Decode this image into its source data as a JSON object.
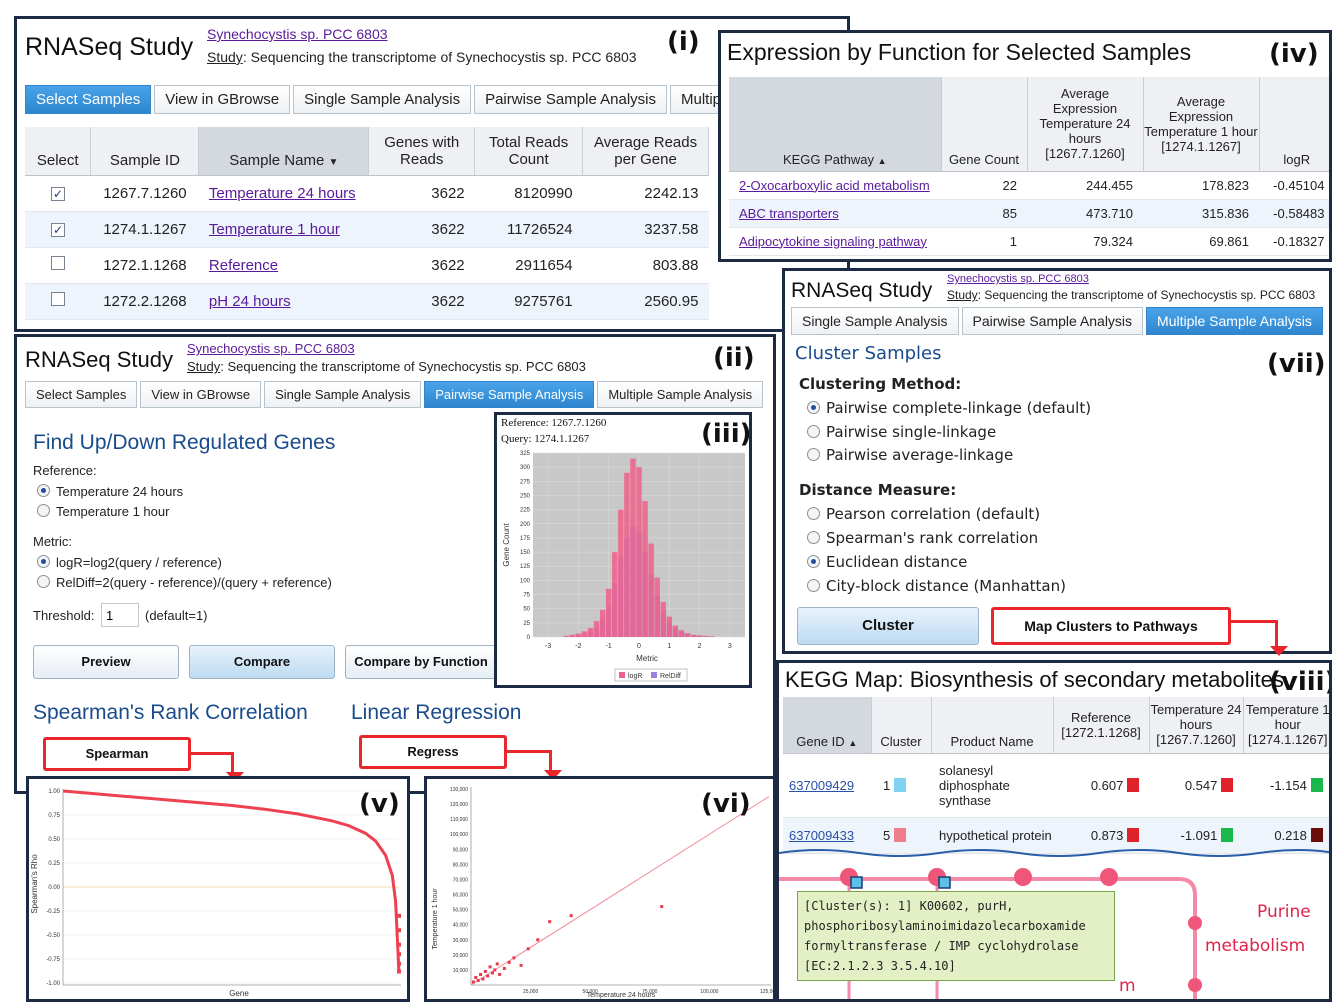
{
  "panel_i": {
    "label": "(i)",
    "title": "RNASeq Study",
    "organism": "Synechocystis sp. PCC 6803",
    "study_key": "Study",
    "study_text": ": Sequencing the transcriptome of Synechocystis sp. PCC 6803",
    "tabs": [
      "Select Samples",
      "View in GBrowse",
      "Single Sample Analysis",
      "Pairwise Sample Analysis",
      "Multip"
    ],
    "columns": [
      "Select",
      "Sample ID",
      "Sample Name",
      "Genes with Reads",
      "Total Reads Count",
      "Average Reads per Gene"
    ],
    "rows": [
      {
        "checked": true,
        "id": "1267.7.1260",
        "name": "Temperature 24 hours",
        "genes": "3622",
        "total": "8120990",
        "avg": "2242.13"
      },
      {
        "checked": true,
        "id": "1274.1.1267",
        "name": "Temperature 1 hour",
        "genes": "3622",
        "total": "11726524",
        "avg": "3237.58"
      },
      {
        "checked": false,
        "id": "1272.1.1268",
        "name": "Reference",
        "genes": "3622",
        "total": "2911654",
        "avg": "803.88"
      },
      {
        "checked": false,
        "id": "1272.2.1268",
        "name": "pH 24 hours",
        "genes": "3622",
        "total": "9275761",
        "avg": "2560.95"
      }
    ]
  },
  "panel_iv": {
    "label": "(iv)",
    "title": "Expression by Function for Selected Samples",
    "columns": [
      "KEGG Pathway",
      "Gene Count",
      "Average Expression Temperature 24 hours [1267.7.1260]",
      "Average Expression Temperature 1 hour [1274.1.1267]",
      "logR"
    ],
    "rows": [
      {
        "pathway": "2-Oxocarboxylic acid metabolism",
        "count": "22",
        "a": "244.455",
        "b": "178.823",
        "logr": "-0.45104"
      },
      {
        "pathway": "ABC transporters",
        "count": "85",
        "a": "473.710",
        "b": "315.836",
        "logr": "-0.58483"
      },
      {
        "pathway": "Adipocytokine signaling pathway",
        "count": "1",
        "a": "79.324",
        "b": "69.861",
        "logr": "-0.18327"
      }
    ]
  },
  "panel_ii": {
    "label": "(ii)",
    "title": "RNASeq Study",
    "organism": "Synechocystis sp. PCC 6803",
    "study_key": "Study",
    "study_text": ": Sequencing the transcriptome of Synechocystis sp. PCC 6803",
    "tabs": [
      "Select Samples",
      "View in GBrowse",
      "Single Sample Analysis",
      "Pairwise Sample Analysis",
      "Multiple Sample Analysis"
    ],
    "heading": "Find Up/Down Regulated Genes",
    "reference_label": "Reference",
    "reference_options": [
      "Temperature 24 hours",
      "Temperature 1 hour"
    ],
    "metric_label": "Metric",
    "metric_options": [
      "logR=log2(query / reference)",
      "RelDiff=2(query - reference)/(query + reference)"
    ],
    "threshold_label": "Threshold",
    "threshold_value": "1",
    "threshold_default": "(default=1)",
    "buttons": [
      "Preview",
      "Compare",
      "Compare by Function"
    ],
    "spearman_title": "Spearman's Rank Correlation",
    "spearman_button": "Spearman",
    "regression_title": "Linear Regression",
    "regression_button": "Regress"
  },
  "panel_iii": {
    "label": "(iii)",
    "reference_line": "Reference: 1267.7.1260",
    "query_line": "Query: 1274.1.1267"
  },
  "panel_v": {
    "label": "(v)"
  },
  "panel_vi": {
    "label": "(vi)"
  },
  "panel_vii": {
    "label": "(vii)",
    "title": "RNASeq Study",
    "organism": "Synechocystis sp. PCC 6803",
    "study_key": "Study",
    "study_text": ": Sequencing the transcriptome of Synechocystis sp. PCC 6803",
    "tabs": [
      "Single Sample Analysis",
      "Pairwise Sample Analysis",
      "Multiple Sample Analysis"
    ],
    "heading": "Cluster Samples",
    "method_label": "Clustering Method",
    "method_options": [
      "Pairwise complete-linkage (default)",
      "Pairwise single-linkage",
      "Pairwise average-linkage"
    ],
    "distance_label": "Distance Measure",
    "distance_options": [
      "Pearson correlation (default)",
      "Spearman's rank correlation",
      "Euclidean distance",
      "City-block distance (Manhattan)"
    ],
    "cluster_button": "Cluster",
    "map_button": "Map Clusters to Pathways"
  },
  "panel_viii": {
    "label": "(viii)",
    "title": "KEGG Map: Biosynthesis of secondary metabolites",
    "columns": [
      "Gene ID",
      "Cluster",
      "Product Name",
      "Reference [1272.1.1268]",
      "Temperature 24 hours [1267.7.1260]",
      "Temperature 1 hour [1274.1.1267]"
    ],
    "rows": [
      {
        "gene": "637009429",
        "cluster": "1",
        "cluster_color": "#7fd3f0",
        "product": "solanesyl diphosphate synthase",
        "ref": "0.607",
        "ref_color": "#e0232a",
        "t24": "0.547",
        "t24_color": "#e0232a",
        "t1": "-1.154",
        "t1_color": "#19b84a"
      },
      {
        "gene": "637009433",
        "cluster": "5",
        "cluster_color": "#ee7f8a",
        "product": "hypothetical protein",
        "ref": "0.873",
        "ref_color": "#e0232a",
        "t24": "-1.091",
        "t24_color": "#19b84a",
        "t1": "0.218",
        "t1_color": "#6b0d0d"
      }
    ],
    "tooltip": "[Cluster(s): 1] K00602, purH, phosphoribosylaminoimidazolecarboxamide formyltransferase / IMP cyclohydrolase [EC:2.1.2.3 3.5.4.10]",
    "map_text_1": "Purine",
    "map_text_2": "metabolism",
    "map_text_3": "m"
  },
  "chart_data": [
    {
      "type": "bar",
      "title": "",
      "xlabel": "Metric",
      "ylabel": "Gene Count",
      "xlim": [
        -3.5,
        3.5
      ],
      "ylim": [
        0,
        325
      ],
      "y_ticks": [
        0,
        25,
        50,
        75,
        100,
        125,
        150,
        175,
        200,
        225,
        250,
        275,
        300,
        325
      ],
      "x_ticks": [
        -3,
        -2,
        -1,
        0,
        1,
        2,
        3
      ],
      "legend": [
        "logR",
        "RelDiff"
      ],
      "series": [
        {
          "name": "logR",
          "color": "#f0608a",
          "x": [
            -2.4,
            -2.2,
            -2.0,
            -1.8,
            -1.6,
            -1.4,
            -1.2,
            -1.0,
            -0.8,
            -0.6,
            -0.4,
            -0.2,
            0.0,
            0.2,
            0.4,
            0.6,
            0.8,
            1.0,
            1.2,
            1.4,
            1.6,
            1.8,
            2.0,
            2.2,
            2.4
          ],
          "values": [
            2,
            4,
            6,
            10,
            16,
            28,
            48,
            85,
            150,
            225,
            290,
            315,
            300,
            240,
            165,
            105,
            62,
            36,
            20,
            12,
            7,
            4,
            3,
            2,
            1
          ]
        },
        {
          "name": "RelDiff",
          "color": "#9a80e0",
          "x": [
            -2.4,
            -2.2,
            -2.0,
            -1.8,
            -1.6,
            -1.4,
            -1.2,
            -1.0,
            -0.8,
            -0.6,
            -0.4,
            -0.2,
            0.0,
            0.2,
            0.4,
            0.6,
            0.8,
            1.0,
            1.2,
            1.4,
            1.6,
            1.8,
            2.0,
            2.2,
            2.4
          ],
          "values": [
            1,
            2,
            3,
            6,
            10,
            18,
            32,
            55,
            95,
            140,
            175,
            195,
            185,
            150,
            110,
            72,
            44,
            26,
            15,
            9,
            5,
            3,
            2,
            1,
            1
          ]
        }
      ]
    },
    {
      "type": "line",
      "title": "",
      "xlabel": "Gene",
      "ylabel": "Spearman's Rho",
      "ylim": [
        -1.0,
        1.0
      ],
      "y_ticks": [
        "1.00",
        "0.75",
        "0.50",
        "0.25",
        "0.00",
        "-0.25",
        "-0.50",
        "-0.75",
        "-1.00"
      ],
      "series": [
        {
          "name": "",
          "color": "#ee4050",
          "x": [
            0,
            0.1,
            0.2,
            0.3,
            0.4,
            0.5,
            0.6,
            0.7,
            0.8,
            0.85,
            0.9,
            0.93,
            0.96,
            0.98,
            0.99,
            1.0
          ],
          "values": [
            1.0,
            0.97,
            0.94,
            0.91,
            0.88,
            0.85,
            0.81,
            0.76,
            0.69,
            0.64,
            0.56,
            0.48,
            0.33,
            0.12,
            -0.15,
            -0.9
          ]
        }
      ]
    },
    {
      "type": "scatter",
      "title": "",
      "xlabel": "Temperature 24 hours",
      "ylabel": "Temperature 1 hour",
      "xlim": [
        0,
        125000
      ],
      "ylim": [
        0,
        130000
      ],
      "x_ticks": [
        "25,000",
        "50,000",
        "75,000",
        "100,000",
        "125,000"
      ],
      "y_ticks": [
        "10,000",
        "20,000",
        "30,000",
        "40,000",
        "50,000",
        "60,000",
        "70,000",
        "80,000",
        "90,000",
        "100,000",
        "110,000",
        "120,000",
        "130,000"
      ],
      "series": [
        {
          "name": "",
          "color": "#e63a4a",
          "x": [
            1000,
            2000,
            3000,
            4000,
            5000,
            6000,
            7000,
            8000,
            9000,
            10000,
            11000,
            12000,
            14000,
            16000,
            18000,
            21000,
            24000,
            28000,
            33000,
            42000,
            80000
          ],
          "values": [
            2000,
            5000,
            3000,
            7000,
            4000,
            9000,
            6000,
            12000,
            8000,
            10000,
            14000,
            7000,
            11000,
            15000,
            18000,
            13000,
            24000,
            30000,
            42000,
            46000,
            52000
          ]
        }
      ],
      "trendline": {
        "slope": 1.0,
        "intercept": 0
      }
    }
  ]
}
